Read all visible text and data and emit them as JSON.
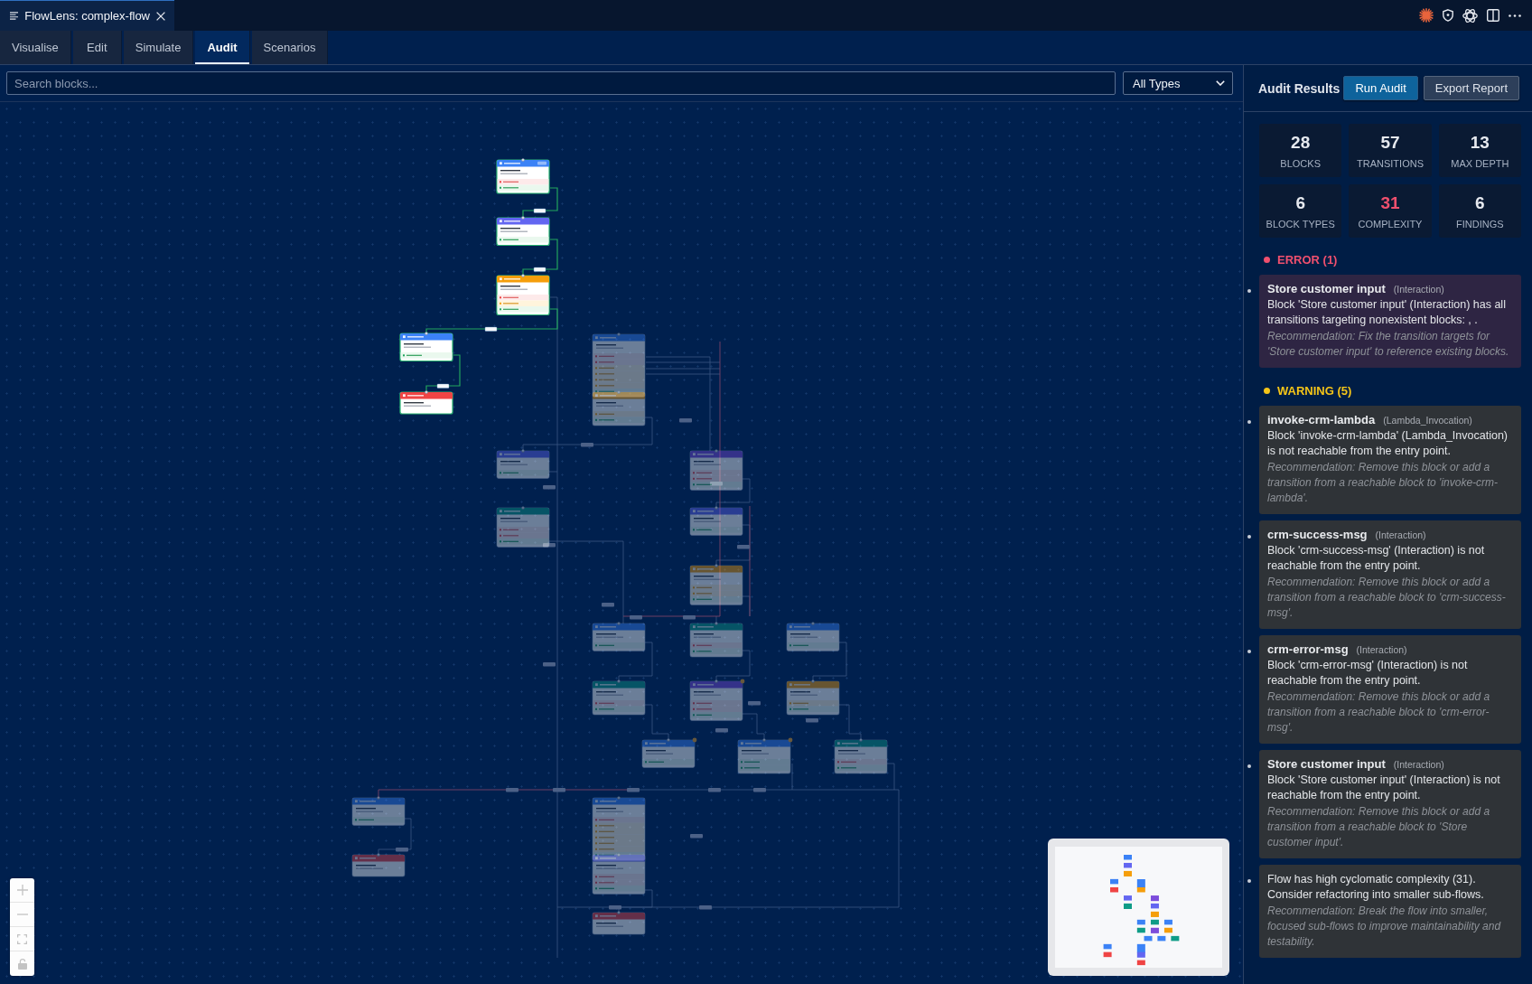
{
  "editor_tab": {
    "title": "FlowLens: complex-flow"
  },
  "tabs": [
    {
      "label": "Visualise",
      "selected": false
    },
    {
      "label": "Edit",
      "selected": false
    },
    {
      "label": "Simulate",
      "selected": false
    },
    {
      "label": "Audit",
      "selected": true
    },
    {
      "label": "Scenarios",
      "selected": false
    }
  ],
  "search": {
    "placeholder": "Search blocks..."
  },
  "type_filter": {
    "value": "All Types"
  },
  "canvas": {
    "nodes": [
      {
        "kind": "interaction",
        "dimmed": false,
        "entry": true,
        "warning": false,
        "outputs": [
          {
            "kind": "error"
          },
          {
            "kind": "default"
          }
        ]
      },
      {
        "kind": "set_attributes",
        "dimmed": false,
        "entry": false,
        "warning": false,
        "outputs": [
          {
            "kind": "default"
          }
        ]
      },
      {
        "kind": "logic",
        "dimmed": false,
        "entry": false,
        "warning": false,
        "outputs": [
          {
            "kind": "error"
          },
          {
            "kind": "warning"
          },
          {
            "kind": "default"
          }
        ]
      },
      {
        "kind": "interaction",
        "dimmed": false,
        "entry": false,
        "warning": false,
        "outputs": [
          {
            "kind": "default"
          }
        ]
      },
      {
        "kind": "termination",
        "dimmed": false,
        "entry": false,
        "warning": false
      },
      {
        "kind": "interaction",
        "dimmed": true,
        "entry": false,
        "warning": false,
        "outputs": [
          {
            "kind": "error"
          },
          {
            "kind": "error"
          },
          {
            "kind": "warning"
          },
          {
            "kind": "warning"
          },
          {
            "kind": "warning"
          },
          {
            "kind": "warning"
          },
          {
            "kind": "default"
          }
        ]
      },
      {
        "kind": "logic",
        "dimmed": true,
        "entry": false,
        "warning": false,
        "outputs": [
          {
            "kind": "warning"
          },
          {
            "kind": "default"
          }
        ]
      },
      {
        "kind": "set_attributes",
        "dimmed": true,
        "entry": false,
        "warning": false,
        "outputs": [
          {
            "kind": "default"
          }
        ]
      },
      {
        "kind": "lambda",
        "dimmed": true,
        "entry": false,
        "warning": false,
        "outputs": [
          {
            "kind": "error"
          },
          {
            "kind": "error"
          },
          {
            "kind": "default"
          }
        ]
      },
      {
        "kind": "queue_transfer",
        "dimmed": true,
        "entry": false,
        "warning": false,
        "outputs": [
          {
            "kind": "error"
          },
          {
            "kind": "error"
          },
          {
            "kind": "default"
          }
        ]
      },
      {
        "kind": "set_attributes",
        "dimmed": true,
        "entry": false,
        "warning": false,
        "outputs": [
          {
            "kind": "default"
          }
        ]
      },
      {
        "kind": "logic",
        "dimmed": true,
        "entry": false,
        "warning": false,
        "outputs": [
          {
            "kind": "warning"
          },
          {
            "kind": "warning"
          },
          {
            "kind": "default"
          }
        ]
      },
      {
        "kind": "interaction",
        "dimmed": true,
        "entry": false,
        "warning": false,
        "outputs": [
          {
            "kind": "default"
          }
        ]
      },
      {
        "kind": "queue_transfer",
        "dimmed": true,
        "entry": false,
        "warning": false,
        "outputs": [
          {
            "kind": "error"
          },
          {
            "kind": "default"
          }
        ]
      },
      {
        "kind": "interaction",
        "dimmed": true,
        "entry": false,
        "warning": false,
        "outputs": [
          {
            "kind": "default"
          }
        ]
      },
      {
        "kind": "queue_transfer",
        "dimmed": true,
        "entry": false,
        "warning": false,
        "outputs": [
          {
            "kind": "error"
          },
          {
            "kind": "default"
          }
        ]
      },
      {
        "kind": "lambda",
        "dimmed": true,
        "entry": false,
        "warning": true,
        "outputs": [
          {
            "kind": "error"
          },
          {
            "kind": "error"
          },
          {
            "kind": "default"
          }
        ]
      },
      {
        "kind": "logic",
        "dimmed": true,
        "entry": false,
        "warning": false,
        "outputs": [
          {
            "kind": "warning"
          },
          {
            "kind": "default"
          }
        ]
      },
      {
        "kind": "interaction",
        "dimmed": true,
        "entry": false,
        "warning": true,
        "outputs": [
          {
            "kind": "default"
          }
        ]
      },
      {
        "kind": "interaction",
        "dimmed": true,
        "entry": false,
        "warning": true,
        "outputs": [
          {
            "kind": "default"
          },
          {
            "kind": "default"
          }
        ]
      },
      {
        "kind": "queue_transfer",
        "dimmed": true,
        "entry": false,
        "warning": false,
        "outputs": [
          {
            "kind": "error"
          },
          {
            "kind": "default"
          }
        ]
      },
      {
        "kind": "interaction",
        "dimmed": true,
        "entry": false,
        "warning": false,
        "outputs": [
          {
            "kind": "default"
          }
        ]
      },
      {
        "kind": "termination",
        "dimmed": true,
        "entry": false,
        "warning": false
      },
      {
        "kind": "interaction",
        "dimmed": true,
        "entry": false,
        "warning": false,
        "outputs": [
          {
            "kind": "error"
          },
          {
            "kind": "warning"
          },
          {
            "kind": "warning"
          },
          {
            "kind": "warning"
          },
          {
            "kind": "warning"
          },
          {
            "kind": "warning"
          },
          {
            "kind": "default"
          }
        ]
      },
      {
        "kind": "set_attributes",
        "dimmed": true,
        "entry": false,
        "warning": false,
        "outputs": [
          {
            "kind": "error"
          },
          {
            "kind": "error"
          },
          {
            "kind": "default"
          }
        ]
      },
      {
        "kind": "termination",
        "dimmed": true,
        "entry": false,
        "warning": false
      }
    ]
  },
  "audit": {
    "title": "Audit Results",
    "buttons": [
      {
        "label": "Run Audit",
        "kind": "primary"
      },
      {
        "label": "Export Report",
        "kind": "secondary"
      }
    ],
    "stats": [
      {
        "value": "28",
        "label": "BLOCKS",
        "alert": false
      },
      {
        "value": "57",
        "label": "TRANSITIONS",
        "alert": false
      },
      {
        "value": "13",
        "label": "MAX DEPTH",
        "alert": false
      },
      {
        "value": "6",
        "label": "BLOCK TYPES",
        "alert": false
      },
      {
        "value": "31",
        "label": "COMPLEXITY",
        "alert": true
      },
      {
        "value": "6",
        "label": "FINDINGS",
        "alert": false
      }
    ],
    "sections": [
      {
        "label": "ERROR (1)",
        "kind": "error",
        "findings": [
          {
            "block": "Store customer input",
            "type": "(Interaction)",
            "message": "Block 'Store customer input' (Interaction) has all transitions targeting nonexistent blocks: , .",
            "recommendation": "Recommendation: Fix the transition targets for 'Store customer input' to reference existing blocks."
          }
        ]
      },
      {
        "label": "WARNING (5)",
        "kind": "warning",
        "findings": [
          {
            "block": "invoke-crm-lambda",
            "type": "(Lambda_Invocation)",
            "message": "Block 'invoke-crm-lambda' (Lambda_Invocation) is not reachable from the entry point.",
            "recommendation": "Recommendation: Remove this block or add a transition from a reachable block to 'invoke-crm-lambda'."
          },
          {
            "block": "crm-success-msg",
            "type": "(Interaction)",
            "message": "Block 'crm-success-msg' (Interaction) is not reachable from the entry point.",
            "recommendation": "Recommendation: Remove this block or add a transition from a reachable block to 'crm-success-msg'."
          },
          {
            "block": "crm-error-msg",
            "type": "(Interaction)",
            "message": "Block 'crm-error-msg' (Interaction) is not reachable from the entry point.",
            "recommendation": "Recommendation: Remove this block or add a transition from a reachable block to 'crm-error-msg'."
          },
          {
            "block": "Store customer input",
            "type": "(Interaction)",
            "message": "Block 'Store customer input' (Interaction) is not reachable from the entry point.",
            "recommendation": "Recommendation: Remove this block or add a transition from a reachable block to 'Store customer input'."
          },
          {
            "message": "Flow has high cyclomatic complexity (31). Consider refactoring into smaller sub-flows.",
            "recommendation": "Recommendation: Break the flow into smaller, focused sub-flows to improve maintainability and testability."
          }
        ]
      }
    ]
  }
}
